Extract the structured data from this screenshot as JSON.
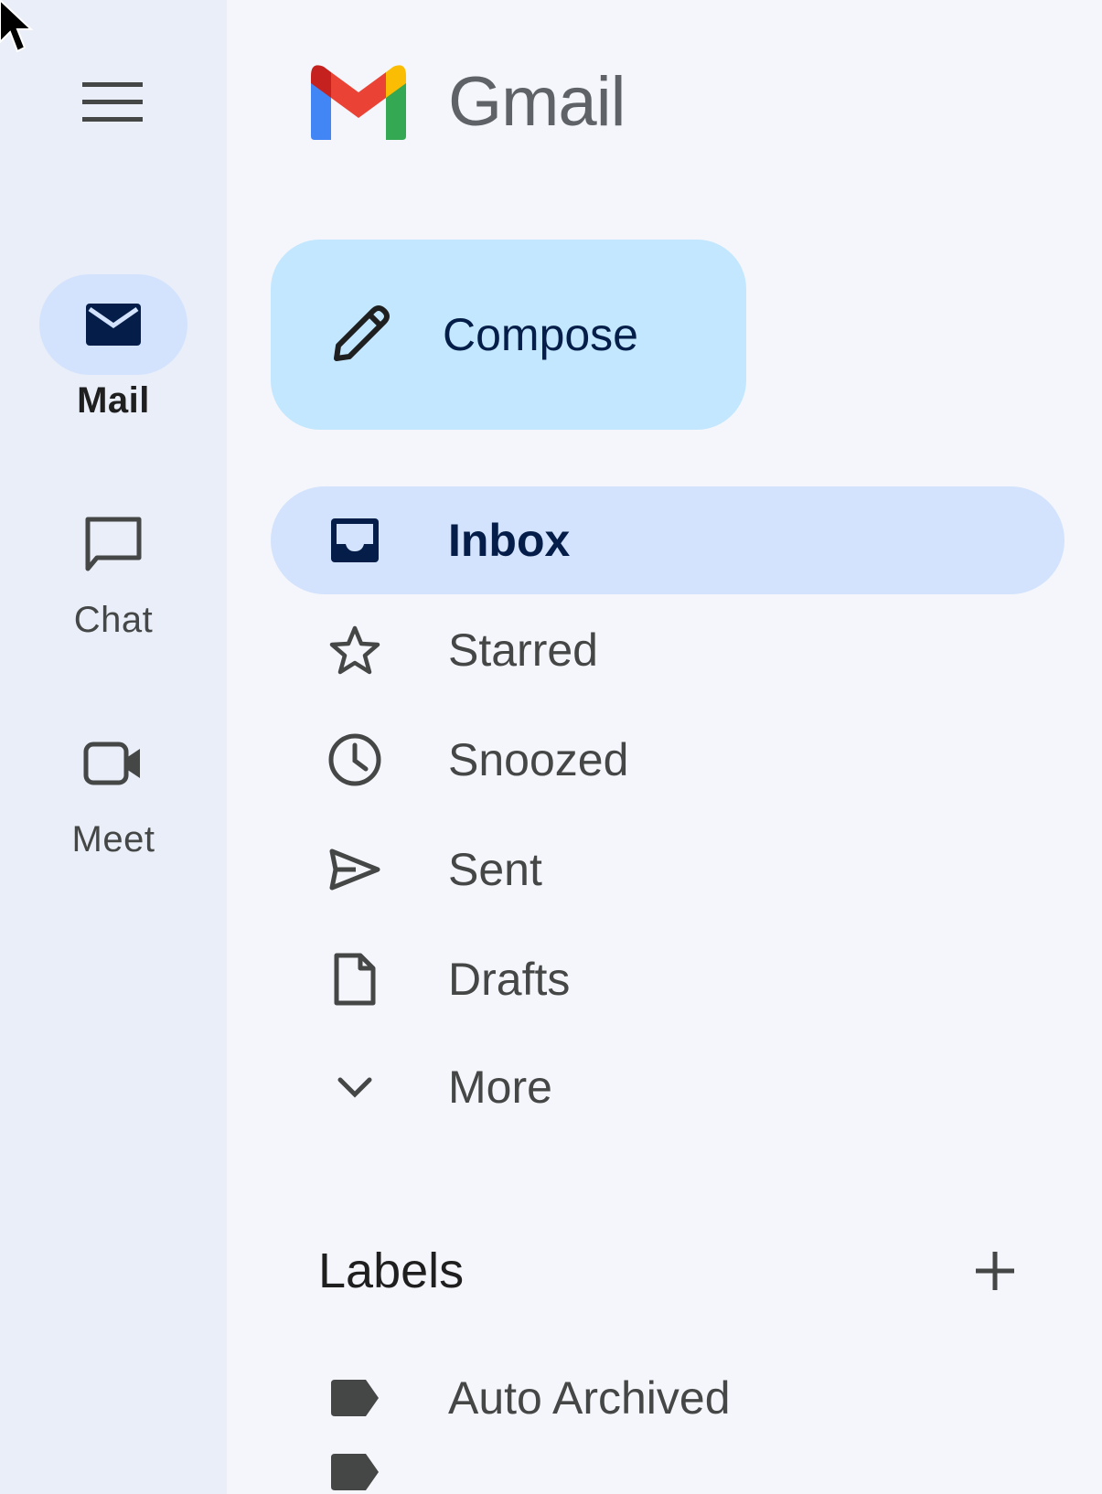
{
  "app": {
    "name": "Gmail"
  },
  "rail": {
    "items": [
      {
        "label": "Mail",
        "icon": "mail-icon",
        "active": true
      },
      {
        "label": "Chat",
        "icon": "chat-icon",
        "active": false
      },
      {
        "label": "Meet",
        "icon": "video-camera-icon",
        "active": false
      }
    ]
  },
  "compose": {
    "label": "Compose"
  },
  "nav": {
    "items": [
      {
        "label": "Inbox",
        "icon": "inbox-icon",
        "active": true
      },
      {
        "label": "Starred",
        "icon": "star-icon"
      },
      {
        "label": "Snoozed",
        "icon": "clock-icon"
      },
      {
        "label": "Sent",
        "icon": "send-icon"
      },
      {
        "label": "Drafts",
        "icon": "draft-icon"
      },
      {
        "label": "More",
        "icon": "chevron-down-icon"
      }
    ]
  },
  "labels": {
    "title": "Labels",
    "items": [
      {
        "label": "Auto Archived",
        "icon": "label-icon"
      }
    ]
  },
  "colors": {
    "rail_bg": "#e9eef8",
    "panel_bg": "#f4f6fb",
    "compose_bg": "#c2e7ff",
    "active_bg": "#d3e3fd",
    "active_text": "#041e49"
  }
}
